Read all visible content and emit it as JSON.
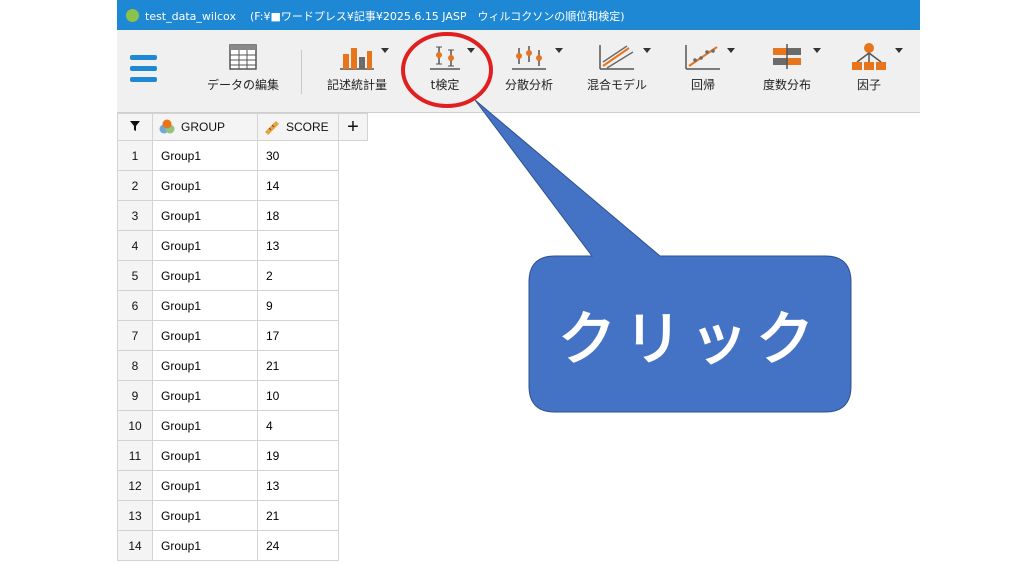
{
  "window": {
    "title": "test_data_wilcox",
    "path": "(F:¥■ワードプレス¥記事¥2025.6.15 JASP　ウィルコクソンの順位和検定)"
  },
  "ribbon": {
    "tools": [
      {
        "id": "data-edit",
        "label": "データの編集",
        "icon": "table-icon"
      },
      {
        "id": "descriptives",
        "label": "記述統計量",
        "icon": "bar-chart-icon"
      },
      {
        "id": "t-test",
        "label": "t検定",
        "icon": "t-test-icon"
      },
      {
        "id": "anova",
        "label": "分散分析",
        "icon": "anova-icon"
      },
      {
        "id": "mixed-models",
        "label": "混合モデル",
        "icon": "mixed-model-icon"
      },
      {
        "id": "regression",
        "label": "回帰",
        "icon": "regression-icon"
      },
      {
        "id": "frequencies",
        "label": "度数分布",
        "icon": "frequencies-icon"
      },
      {
        "id": "factor",
        "label": "因子",
        "icon": "factor-icon"
      }
    ]
  },
  "grid": {
    "columns": [
      {
        "name": "GROUP",
        "icon": "nominal-icon"
      },
      {
        "name": "SCORE",
        "icon": "scale-icon"
      }
    ],
    "add_column_label": "+",
    "rows": [
      {
        "n": "1",
        "group": "Group1",
        "score": "30"
      },
      {
        "n": "2",
        "group": "Group1",
        "score": "14"
      },
      {
        "n": "3",
        "group": "Group1",
        "score": "18"
      },
      {
        "n": "4",
        "group": "Group1",
        "score": "13"
      },
      {
        "n": "5",
        "group": "Group1",
        "score": "2"
      },
      {
        "n": "6",
        "group": "Group1",
        "score": "9"
      },
      {
        "n": "7",
        "group": "Group1",
        "score": "17"
      },
      {
        "n": "8",
        "group": "Group1",
        "score": "21"
      },
      {
        "n": "9",
        "group": "Group1",
        "score": "10"
      },
      {
        "n": "10",
        "group": "Group1",
        "score": "4"
      },
      {
        "n": "11",
        "group": "Group1",
        "score": "19"
      },
      {
        "n": "12",
        "group": "Group1",
        "score": "13"
      },
      {
        "n": "13",
        "group": "Group1",
        "score": "21"
      },
      {
        "n": "14",
        "group": "Group1",
        "score": "24"
      }
    ]
  },
  "annotation": {
    "callout_text": "クリック",
    "callout_color": "#4472c4",
    "highlight_color": "#e02020"
  },
  "colors": {
    "titlebar": "#1e88d4",
    "accent_orange": "#e8741c",
    "icon_gray": "#6b6b6b"
  }
}
